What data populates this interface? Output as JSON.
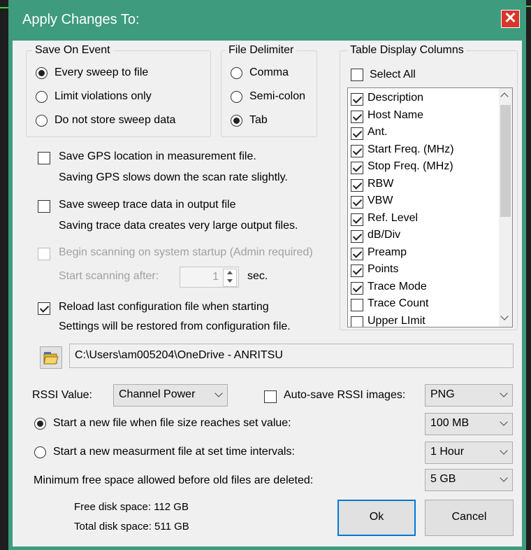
{
  "dialog": {
    "title": "Apply Changes To:",
    "close_icon": "close-icon"
  },
  "save_on_event": {
    "label": "Save On Event",
    "options": [
      {
        "label": "Every sweep to file",
        "selected": true
      },
      {
        "label": "Limit violations only",
        "selected": false
      },
      {
        "label": "Do not store sweep data",
        "selected": false
      }
    ]
  },
  "file_delimiter": {
    "label": "File Delimiter",
    "options": [
      {
        "label": "Comma",
        "selected": false
      },
      {
        "label": "Semi-colon",
        "selected": false
      },
      {
        "label": "Tab",
        "selected": true
      }
    ]
  },
  "table_columns": {
    "label": "Table Display Columns",
    "select_all": "Select All",
    "select_all_checked": false,
    "items": [
      {
        "label": "Description",
        "checked": true
      },
      {
        "label": "Host Name",
        "checked": true
      },
      {
        "label": "Ant.",
        "checked": true
      },
      {
        "label": "Start Freq. (MHz)",
        "checked": true
      },
      {
        "label": "Stop Freq. (MHz)",
        "checked": true
      },
      {
        "label": "RBW",
        "checked": true
      },
      {
        "label": "VBW",
        "checked": true
      },
      {
        "label": "Ref. Level",
        "checked": true
      },
      {
        "label": "dB/Div",
        "checked": true
      },
      {
        "label": "Preamp",
        "checked": true
      },
      {
        "label": "Points",
        "checked": true
      },
      {
        "label": "Trace Mode",
        "checked": true
      },
      {
        "label": "Trace Count",
        "checked": false
      },
      {
        "label": "Upper LImit",
        "checked": false
      }
    ]
  },
  "options": {
    "gps_label": "Save GPS location in measurement file.",
    "gps_note": "Saving GPS slows down the scan rate slightly.",
    "gps_checked": false,
    "trace_label": "Save sweep trace data in output file",
    "trace_note": "Saving trace data creates very large output files.",
    "trace_checked": false,
    "startup_label": "Begin scanning on system startup (Admin required)",
    "startup_after_label": "Start scanning after:",
    "startup_after_value": "1",
    "startup_unit": "sec.",
    "startup_checked": false,
    "reload_label": "Reload last configuration file when starting",
    "reload_note": "Settings will be restored from configuration file.",
    "reload_checked": true
  },
  "path": {
    "value": "C:\\Users\\am005204\\OneDrive - ANRITSU",
    "folder_icon": "folder-open-icon"
  },
  "rssi": {
    "label": "RSSI Value:",
    "value": "Channel Power",
    "autosave_label": "Auto-save RSSI images:",
    "autosave_checked": false,
    "image_format": "PNG"
  },
  "file_rules": {
    "size_label": "Start a new file when file size reaches set value:",
    "size_selected": true,
    "size_value": "100 MB",
    "time_label": "Start a new measurment file at set time intervals:",
    "time_selected": false,
    "time_value": "1 Hour",
    "min_space_label": "Minimum free space allowed before old files are deleted:",
    "min_space_value": "5 GB"
  },
  "disk": {
    "free": "Free disk space: 112 GB",
    "total": "Total disk space: 511 GB"
  },
  "buttons": {
    "ok": "Ok",
    "cancel": "Cancel"
  },
  "colors": {
    "title_bar": "#3e9b7e",
    "close_button": "#d9352b",
    "default_button_border": "#0078d7"
  }
}
